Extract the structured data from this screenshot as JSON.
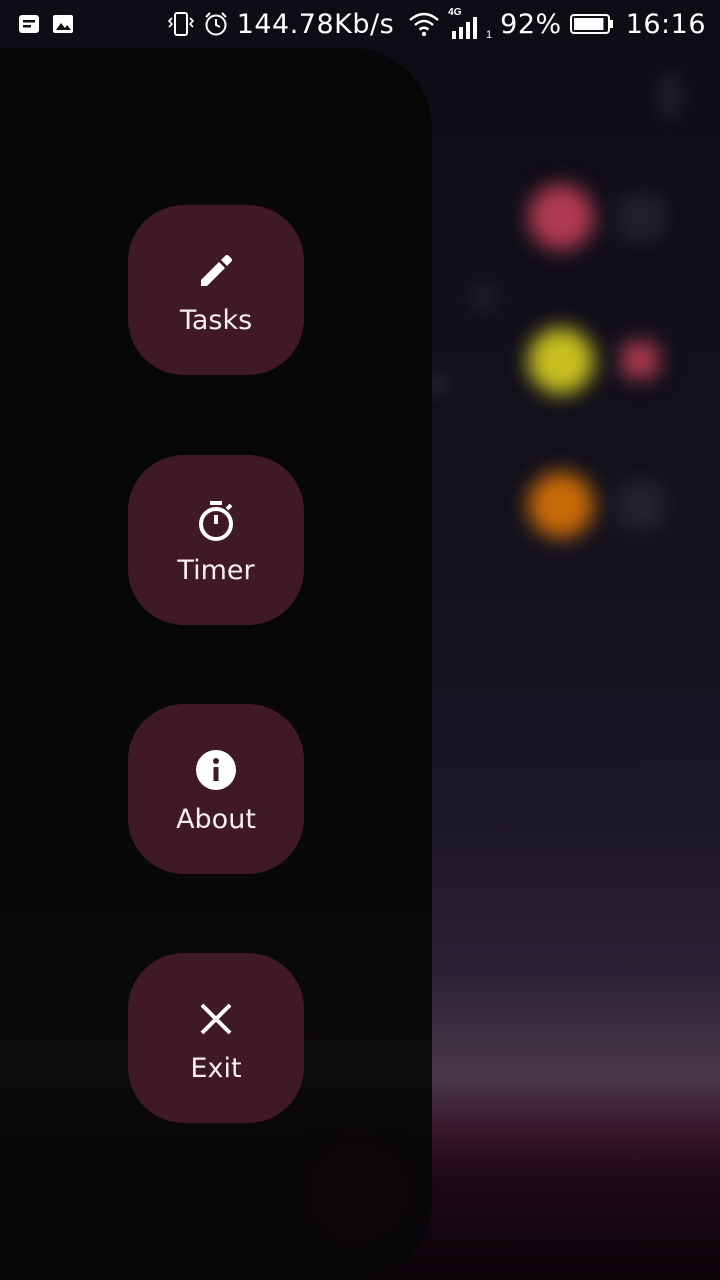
{
  "status_bar": {
    "network_speed": "144.78Kb/s",
    "network_type": "4G",
    "sim_slot": "1",
    "battery_percent": "92%",
    "battery_level": 0.92,
    "time": "16:16",
    "left_icons": [
      "notification-icon",
      "image-icon"
    ],
    "right_icons": [
      "vibrate-icon",
      "alarm-icon",
      "wifi-icon",
      "signal-icon",
      "battery-icon"
    ]
  },
  "drawer": {
    "items": [
      {
        "label": "Tasks",
        "icon": "pencil-icon"
      },
      {
        "label": "Timer",
        "icon": "timer-icon"
      },
      {
        "label": "About",
        "icon": "info-icon"
      },
      {
        "label": "Exit",
        "icon": "close-icon"
      }
    ]
  },
  "colors": {
    "drawer_background": "#060608",
    "menu_button": "#3f1a26",
    "accent_red": "#b03a52",
    "accent_yellow": "#c8c020",
    "accent_orange": "#c86a08"
  }
}
